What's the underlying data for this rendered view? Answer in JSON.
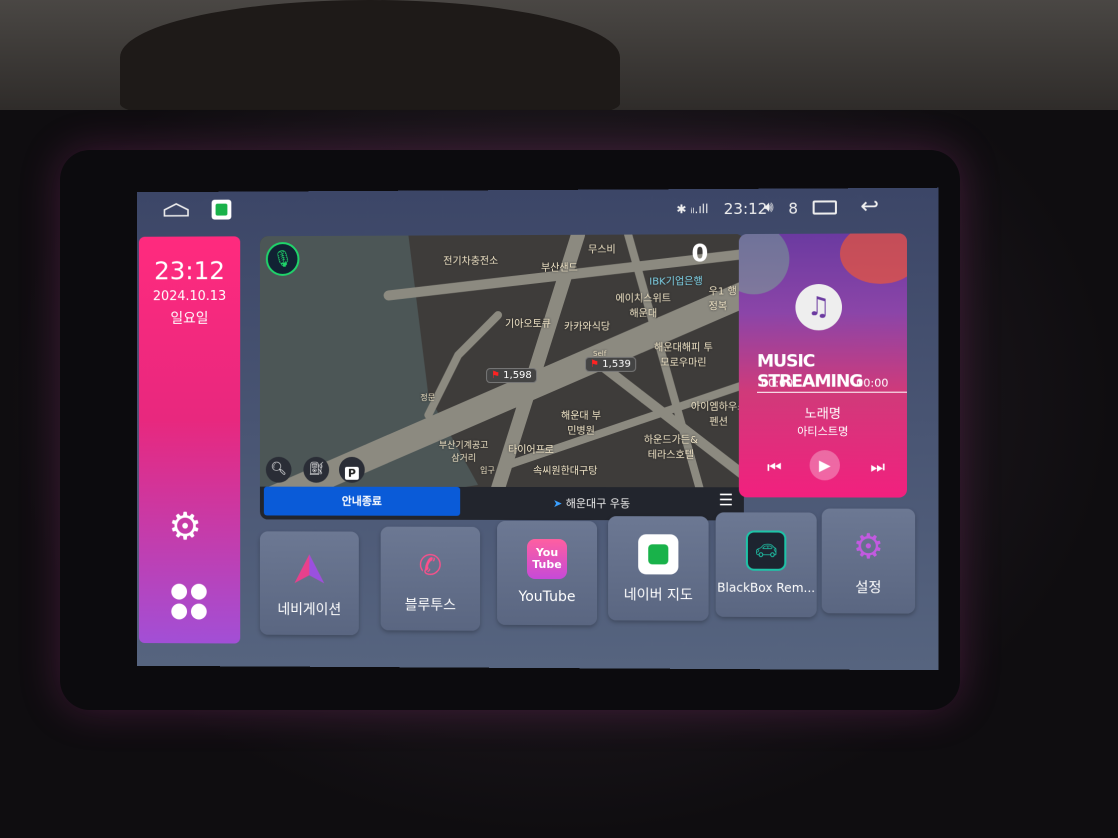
{
  "status_bar": {
    "time": "23:12",
    "volume": "8",
    "icons": [
      "home-icon",
      "naver-map-app-icon",
      "bluetooth-icon",
      "signal-icon",
      "volume-icon",
      "recent-apps-icon",
      "back-icon"
    ]
  },
  "clock_panel": {
    "time": "23:12",
    "date": "2024.10.13",
    "weekday": "일요일"
  },
  "map": {
    "speed": "0",
    "labels": [
      "전기차충전소",
      "부산샌드",
      "무스비",
      "IBK기업은행",
      "에이치스위트 해운대",
      "우1 행정복",
      "기아오토큐",
      "카카와식당",
      "해운대해피 투모로우마린",
      "정문",
      "해운대 부민병원",
      "아이엠하우스 펜션",
      "부산기계공고 삼거리",
      "타이어프로",
      "하운드가든& 테라스호텔",
      "입구",
      "속씨원한대구탕",
      "Self"
    ],
    "fuel_prices": [
      "1,598",
      "1,539"
    ],
    "stop_guidance": "안내종료",
    "location": "해운대구 우동"
  },
  "music": {
    "banner": "MUSIC STREAMING",
    "elapsed": "00:00",
    "duration": "00:00",
    "song": "노래명",
    "artist": "아티스트명"
  },
  "apps": [
    {
      "label": "네비게이션",
      "icon": "navigation-arrow-icon"
    },
    {
      "label": "블루투스",
      "icon": "bluetooth-phone-icon"
    },
    {
      "label": "YouTube",
      "icon": "youtube-icon"
    },
    {
      "label": "네이버 지도",
      "icon": "naver-map-icon"
    },
    {
      "label": "BlackBox Rem...",
      "icon": "blackbox-icon"
    },
    {
      "label": "설정",
      "icon": "settings-gear-icon"
    }
  ],
  "colors": {
    "accent_pink": "#ff2a7e",
    "accent_purple": "#a24fd6",
    "nav_blue": "#0a5bd8",
    "mic_green": "#1fd46a"
  }
}
